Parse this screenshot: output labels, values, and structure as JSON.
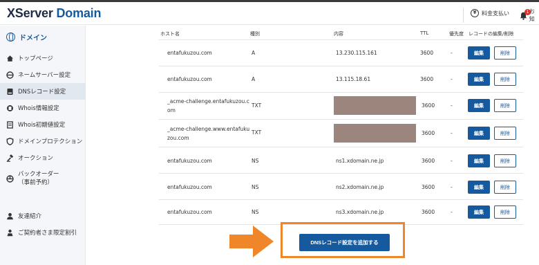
{
  "header": {
    "logo_primary": "XServer",
    "logo_accent": "Domain",
    "pay_label": "料金支払い",
    "pay_icon": "yen-circle-icon",
    "notice_badge": "1",
    "notice_label": "お知"
  },
  "sidebar": {
    "heading": "ドメイン",
    "items": [
      {
        "label": "トップページ",
        "icon": "home-icon"
      },
      {
        "label": "ネームサーバー設定",
        "icon": "server-icon"
      },
      {
        "label": "DNSレコード設定",
        "icon": "dns-icon",
        "active": true
      },
      {
        "label": "Whois情報設定",
        "icon": "whois-icon"
      },
      {
        "label": "Whois初期値設定",
        "icon": "document-icon"
      },
      {
        "label": "ドメインプロテクション",
        "icon": "shield-icon"
      },
      {
        "label": "オークション",
        "icon": "auction-icon"
      },
      {
        "label": "バックオーダー\n（事前予約）",
        "icon": "backorder-icon"
      },
      {
        "label": "友達紹介",
        "icon": "friend-icon"
      },
      {
        "label": "ご契約者さま限定割引",
        "icon": "discount-icon"
      }
    ]
  },
  "table": {
    "headers": {
      "host": "ホスト名",
      "type": "種別",
      "content": "内容",
      "ttl": "TTL",
      "priority": "優先度",
      "actions": "レコードの編集/削除"
    },
    "edit_label": "編集",
    "delete_label": "削除",
    "rows": [
      {
        "host": "entafukuzou.com",
        "type": "A",
        "content": "13.230.115.161",
        "ttl": "3600",
        "priority": "-"
      },
      {
        "host": "entafukuzou.com",
        "type": "A",
        "content": "13.115.18.61",
        "ttl": "3600",
        "priority": "-"
      },
      {
        "host": "_acme-challenge.entafukuzou.c\nom",
        "type": "TXT",
        "content": "",
        "masked": true,
        "ttl": "3600",
        "priority": "-"
      },
      {
        "host": "_acme-challenge.www.entafuku\nzou.com",
        "type": "TXT",
        "content": "",
        "masked": true,
        "ttl": "3600",
        "priority": "-"
      },
      {
        "host": "entafukuzou.com",
        "type": "NS",
        "content": "ns1.xdomain.ne.jp",
        "ttl": "3600",
        "priority": "-"
      },
      {
        "host": "entafukuzou.com",
        "type": "NS",
        "content": "ns2.xdomain.ne.jp",
        "ttl": "3600",
        "priority": "-"
      },
      {
        "host": "entafukuzou.com",
        "type": "NS",
        "content": "ns3.xdomain.ne.jp",
        "ttl": "3600",
        "priority": "-"
      }
    ]
  },
  "add_button_label": "DNSレコード設定を追加する",
  "colors": {
    "brand": "#15599e",
    "highlight": "#f0862a",
    "mask": "#9c857d"
  }
}
